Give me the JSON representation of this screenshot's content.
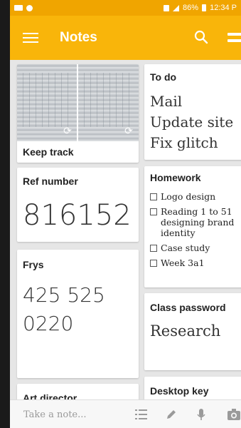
{
  "status_bar": {
    "battery_percent": "86%",
    "time": "12:34 P"
  },
  "app_bar": {
    "title": "Notes"
  },
  "notes": {
    "keep_track": {
      "title": "Keep track"
    },
    "to_do": {
      "title": "To do",
      "lines": [
        "Mail",
        "Update site",
        "Fix glitch"
      ]
    },
    "ref_number": {
      "title": "Ref number",
      "value": "816152"
    },
    "homework": {
      "title": "Homework",
      "items": [
        "Logo design",
        "Reading 1 to 51 designing brand identity",
        "Case study",
        "Week 3a1"
      ]
    },
    "frys": {
      "title": "Frys",
      "line1": "425 525",
      "line2": "0220"
    },
    "class_password": {
      "title": "Class password",
      "value": "Research"
    },
    "art_director": {
      "title": "Art director"
    },
    "desktop_key": {
      "title": "Desktop key"
    }
  },
  "bottom_bar": {
    "placeholder": "Take a note..."
  },
  "icons": {
    "menu": "hamburger-icon",
    "search": "search-icon",
    "layout": "view-layout-icon",
    "sync": "sync-icon",
    "list": "list-icon",
    "pen": "pen-icon",
    "mic": "mic-icon",
    "camera": "camera-icon"
  },
  "colors": {
    "app_bar": "#f9b50a",
    "status_bar": "#f0a500",
    "background": "#e6e6e6"
  }
}
